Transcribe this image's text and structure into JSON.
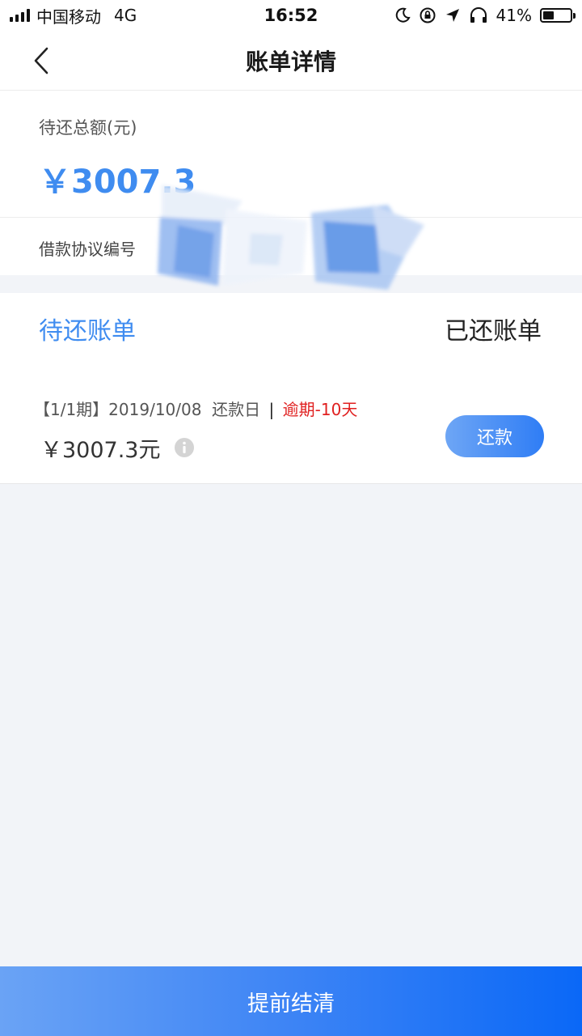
{
  "status_bar": {
    "carrier": "中国移动",
    "network": "4G",
    "time": "16:52",
    "battery_percent_label": "41%",
    "battery_level": 0.41
  },
  "nav": {
    "title": "账单详情"
  },
  "summary": {
    "total_label": "待还总额(元)",
    "total_amount": "￥3007.3",
    "contract_label": "借款协议编号"
  },
  "tabs": [
    {
      "label": "待还账单",
      "active": true
    },
    {
      "label": "已还账单",
      "active": false
    }
  ],
  "bill": {
    "period": "【1/1期】2019/10/08  还款日",
    "separator": "|",
    "overdue": "逾期-10天",
    "amount": "￥3007.3元",
    "pay_label": "还款"
  },
  "footer": {
    "settle_label": "提前结清"
  },
  "colors": {
    "accent": "#3f8cf0",
    "overdue": "#e02020",
    "background": "#f2f4f8"
  }
}
